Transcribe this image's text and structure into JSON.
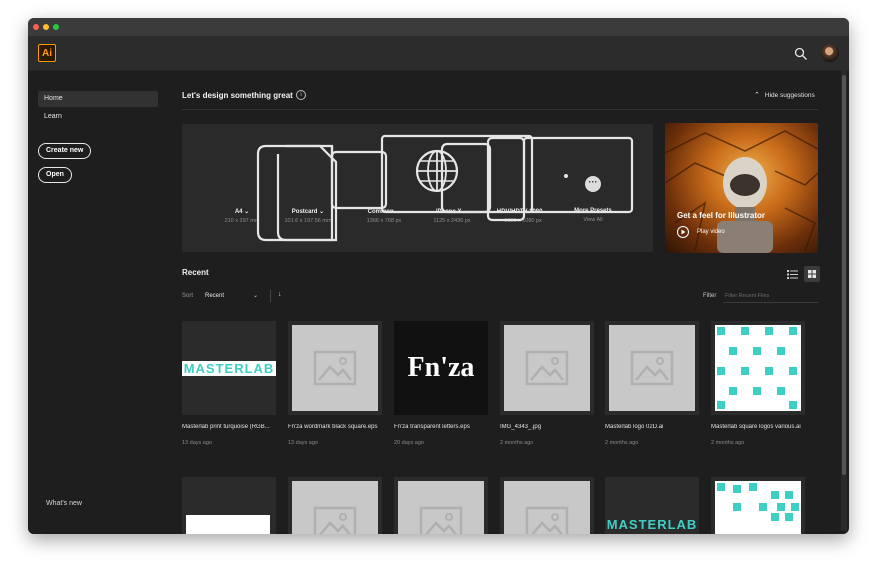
{
  "app": {
    "logo_text": "Ai",
    "accent": "#ff9a00",
    "background": "#1e1e1e"
  },
  "window_controls": [
    {
      "name": "close-button",
      "color": "#fe5f57"
    },
    {
      "name": "minimize-button",
      "color": "#febc2e"
    },
    {
      "name": "maximize-button",
      "color": "#28c840"
    }
  ],
  "header": {
    "search_icon": "search-icon",
    "avatar": "user-avatar"
  },
  "sidebar": {
    "items": [
      {
        "label": "Home",
        "active": true
      },
      {
        "label": "Learn",
        "active": false
      }
    ],
    "create_new_label": "Create new",
    "open_label": "Open",
    "whats_new_label": "What's new"
  },
  "main": {
    "heading": "Let's design something great",
    "hide_suggestions_label": "Hide suggestions",
    "presets": [
      {
        "label": "A4",
        "size": "210 x 297 mm"
      },
      {
        "label": "Postcard",
        "size": "101.6 x 197.56 mm"
      },
      {
        "label": "Common",
        "size": "1366 x 768 px"
      },
      {
        "label": "iPhone X",
        "size": "1125 x 2436 px"
      },
      {
        "label": "HDV/HDTV 1080",
        "size": "1920 x 1080 px"
      },
      {
        "label": "More Presets",
        "size": "View All"
      }
    ],
    "video": {
      "title": "Get a feel for Illustrator",
      "play_label": "Play video"
    },
    "recent": {
      "title": "Recent",
      "sort_label": "Sort",
      "sort_value": "Recent",
      "filter_label": "Filter",
      "filter_placeholder": "Filter Recent Files"
    },
    "files": [
      {
        "name": "Masterlab print turquoise (RGB...",
        "date": "13 days ago",
        "thumb": "masterlab"
      },
      {
        "name": "Fn'za wordmark black square.eps",
        "date": "13 days ago",
        "thumb": "placeholder"
      },
      {
        "name": "Fn'za transparent letters.eps",
        "date": "20 days ago",
        "thumb": "fnza"
      },
      {
        "name": "IMG_4343_.jpg",
        "date": "2 months ago",
        "thumb": "placeholder"
      },
      {
        "name": "Masterlab logo 02D.ai",
        "date": "2 months ago",
        "thumb": "placeholder"
      },
      {
        "name": "Masterlab square logos various.ai",
        "date": "2 months ago",
        "thumb": "squares"
      },
      {
        "name": "",
        "date": "",
        "thumb": "white-bar"
      },
      {
        "name": "",
        "date": "",
        "thumb": "placeholder"
      },
      {
        "name": "",
        "date": "",
        "thumb": "placeholder"
      },
      {
        "name": "",
        "date": "",
        "thumb": "placeholder"
      },
      {
        "name": "",
        "date": "",
        "thumb": "masterlab"
      },
      {
        "name": "",
        "date": "",
        "thumb": "squares2"
      }
    ],
    "thumb_texts": {
      "masterlab": "MASTERLAB",
      "fnza": "Fn'za"
    },
    "teal": "#3ecfc4"
  }
}
